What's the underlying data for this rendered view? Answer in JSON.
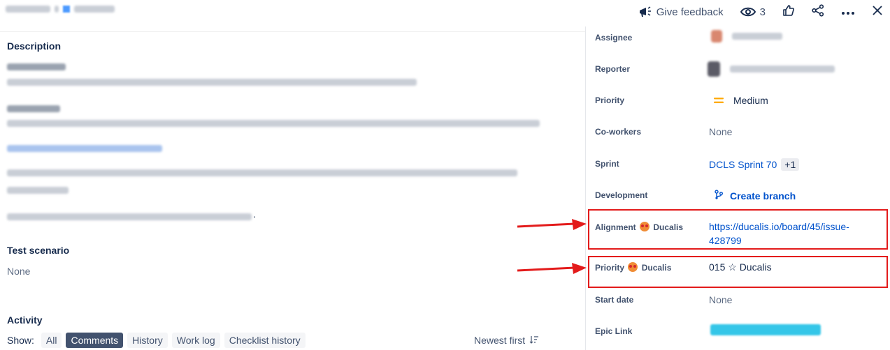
{
  "header": {
    "feedback_label": "Give feedback",
    "watchers_count": "3",
    "icons": [
      "megaphone-icon",
      "eye-icon",
      "thumbs-up-icon",
      "share-icon",
      "more-icon",
      "close-icon"
    ]
  },
  "main": {
    "description_title": "Description",
    "description_period": ".",
    "test_scenario_title": "Test scenario",
    "test_scenario_value": "None",
    "activity_title": "Activity",
    "show_label": "Show:",
    "filters": [
      "All",
      "Comments",
      "History",
      "Work log",
      "Checklist history"
    ],
    "active_filter": "Comments",
    "sort_label": "Newest first"
  },
  "sidebar": {
    "assignee_label": "Assignee",
    "reporter_label": "Reporter",
    "priority_label": "Priority",
    "priority_value": "Medium",
    "coworkers_label": "Co-workers",
    "coworkers_value": "None",
    "sprint_label": "Sprint",
    "sprint_value": "DCLS Sprint 70",
    "sprint_extra": "+1",
    "development_label": "Development",
    "development_value": "Create branch",
    "alignment_label_pre": "Alignment",
    "alignment_label_post": "Ducalis",
    "alignment_line1": "https://ducalis.io/board/45/issue-",
    "alignment_line2": "428799",
    "priority_ducalis_label_pre": "Priority",
    "priority_ducalis_label_post": "Ducalis",
    "priority_ducalis_value": "015 ☆ Ducalis",
    "start_date_label": "Start date",
    "start_date_value": "None",
    "epic_link_label": "Epic Link"
  },
  "colors": {
    "link": "#0052CC",
    "highlight": "#e31b1b",
    "priority_medium": "#FFAB00",
    "active_chip": "#42526E"
  }
}
